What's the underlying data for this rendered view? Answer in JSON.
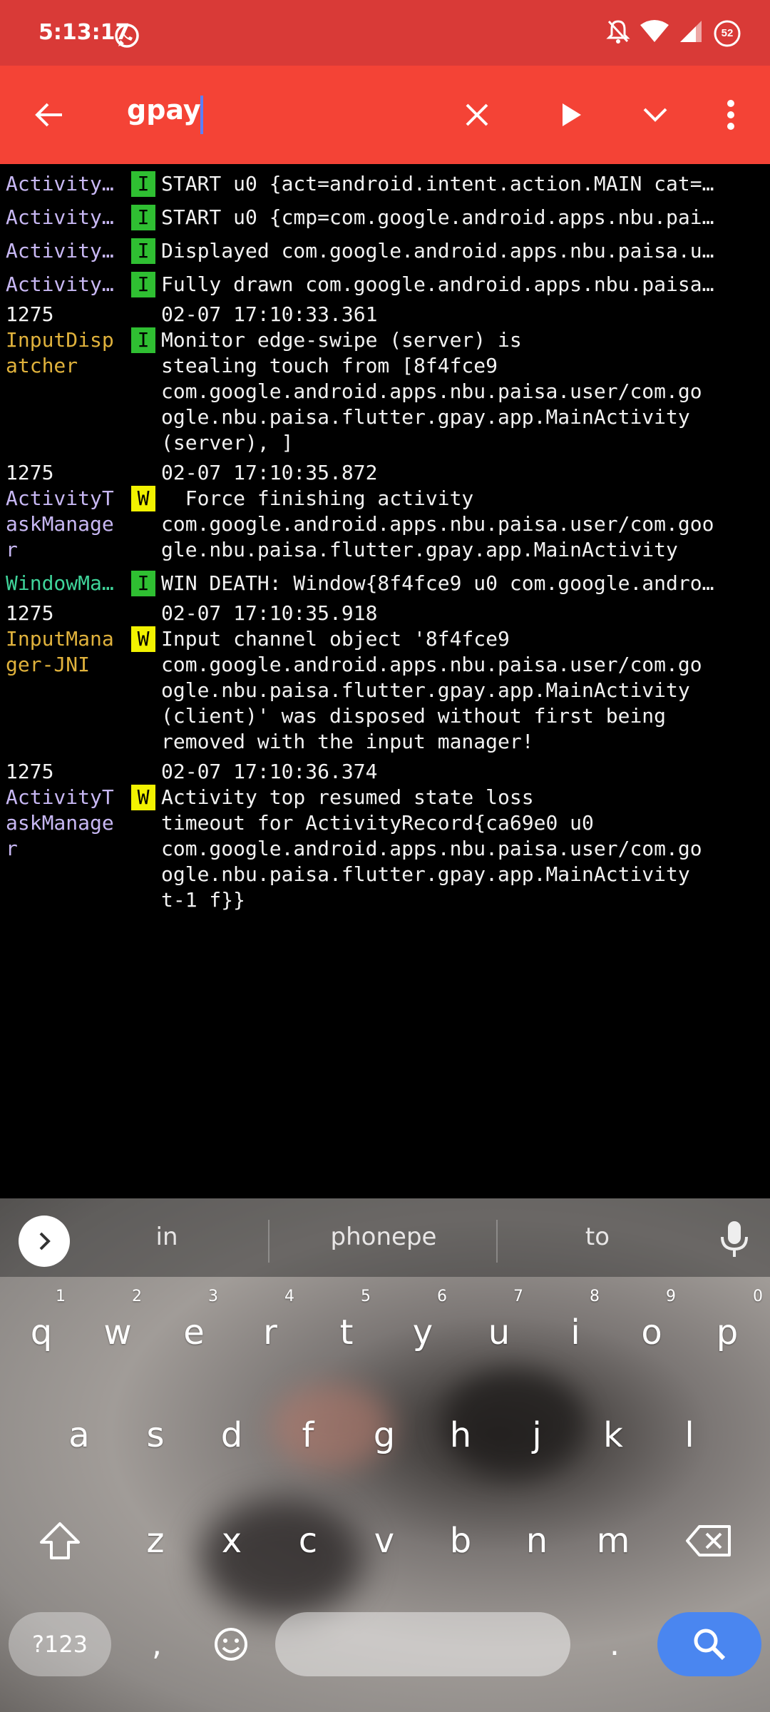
{
  "status_bar": {
    "time": "5:13:17",
    "battery_level": "52",
    "icons": [
      "whatsapp-icon",
      "mute-icon",
      "wifi-icon",
      "signal-icon",
      "battery-saver-icon"
    ]
  },
  "toolbar": {
    "search_query": "gpay",
    "icons": [
      "back-arrow-icon",
      "clear-icon",
      "play-icon",
      "chevron-down-icon",
      "more-vert-icon"
    ]
  },
  "log_entries": [
    {
      "tag": "Activity…",
      "level": "I",
      "message": "START u0 {act=android.intent.action.MAIN cat=…"
    },
    {
      "tag": "Activity…",
      "level": "I",
      "message": "START u0 {cmp=com.google.android.apps.nbu.pai…"
    },
    {
      "tag": "Activity…",
      "level": "I",
      "message": "Displayed com.google.android.apps.nbu.paisa.u…"
    },
    {
      "tag": "Activity…",
      "level": "I",
      "message": "Fully drawn com.google.android.apps.nbu.paisa…"
    },
    {
      "pid": "1275",
      "timestamp": "02-07 17:10:33.361",
      "tag": "InputDisp\natcher",
      "level": "I",
      "message": "Monitor edge-swipe (server) is\nstealing touch from [8f4fce9\ncom.google.android.apps.nbu.paisa.user/com.go\nogle.nbu.paisa.flutter.gpay.app.MainActivity\n(server), ]"
    },
    {
      "pid": "1275",
      "timestamp": "02-07 17:10:35.872",
      "tag": "ActivityT\naskManage\nr",
      "level": "W",
      "message": "  Force finishing activity\ncom.google.android.apps.nbu.paisa.user/com.goo\ngle.nbu.paisa.flutter.gpay.app.MainActivity"
    },
    {
      "tag": "WindowMa…",
      "level": "I",
      "message": "WIN DEATH: Window{8f4fce9 u0 com.google.andro…"
    },
    {
      "pid": "1275",
      "timestamp": "02-07 17:10:35.918",
      "tag": "InputMana\nger-JNI",
      "level": "W",
      "message": "Input channel object '8f4fce9\ncom.google.android.apps.nbu.paisa.user/com.go\nogle.nbu.paisa.flutter.gpay.app.MainActivity\n(client)' was disposed without first being\nremoved with the input manager!"
    },
    {
      "pid": "1275",
      "timestamp": "02-07 17:10:36.374",
      "tag": "ActivityT\naskManage\nr",
      "level": "W",
      "message": "Activity top resumed state loss\ntimeout for ActivityRecord{ca69e0 u0\ncom.google.android.apps.nbu.paisa.user/com.go\nogle.nbu.paisa.flutter.gpay.app.MainActivity\nt-1 f}}"
    }
  ],
  "keyboard": {
    "suggestions": [
      "in",
      "phonepe",
      "to"
    ],
    "row1": [
      {
        "key": "q",
        "hint": "1"
      },
      {
        "key": "w",
        "hint": "2"
      },
      {
        "key": "e",
        "hint": "3"
      },
      {
        "key": "r",
        "hint": "4"
      },
      {
        "key": "t",
        "hint": "5"
      },
      {
        "key": "y",
        "hint": "6"
      },
      {
        "key": "u",
        "hint": "7"
      },
      {
        "key": "i",
        "hint": "8"
      },
      {
        "key": "o",
        "hint": "9"
      },
      {
        "key": "p",
        "hint": "0"
      }
    ],
    "row2": [
      "a",
      "s",
      "d",
      "f",
      "g",
      "h",
      "j",
      "k",
      "l"
    ],
    "row3": [
      "z",
      "x",
      "c",
      "v",
      "b",
      "n",
      "m"
    ],
    "symbols_label": "?123",
    "comma": ",",
    "period": "."
  }
}
